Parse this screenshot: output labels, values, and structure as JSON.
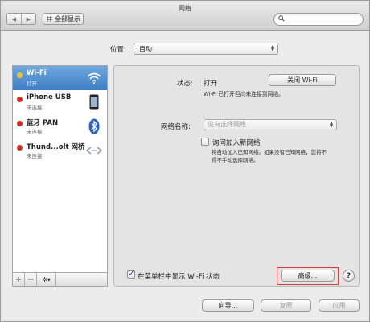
{
  "window": {
    "title": "网络"
  },
  "toolbar": {
    "back_label": "◀",
    "forward_label": "▶",
    "show_all_label": "全部显示",
    "search_placeholder": ""
  },
  "location": {
    "label": "位置:",
    "value": "自动"
  },
  "services": [
    {
      "name": "Wi-Fi",
      "status": "打开",
      "dot_color": "#f2c230",
      "icon": "wifi-icon",
      "selected": true
    },
    {
      "name": "iPhone USB",
      "status": "未连接",
      "dot_color": "#d9291c",
      "icon": "iphone-icon",
      "selected": false
    },
    {
      "name": "蓝牙 PAN",
      "status": "未连接",
      "dot_color": "#d9291c",
      "icon": "bluetooth-icon",
      "selected": false
    },
    {
      "name": "Thund...olt 网桥",
      "status": "未连接",
      "dot_color": "#d9291c",
      "icon": "thunderbolt-bridge-icon",
      "selected": false
    }
  ],
  "sidebar_controls": {
    "add": "+",
    "remove": "−",
    "action": "✲▾"
  },
  "detail": {
    "status_label": "状态:",
    "status_value": "打开",
    "toggle_button": "关闭 Wi-Fi",
    "status_desc": "Wi-Fi 已打开但尚未连接到网络。",
    "network_name_label": "网络名称:",
    "network_name_placeholder": "没有选择网络",
    "ask_join_label": "询问加入新网络",
    "ask_join_checked": false,
    "ask_join_desc_line1": "将自动加入已知网络。如果没有已知网络，您将不",
    "ask_join_desc_line2": "得不手动选择网络。",
    "show_menu_label": "在菜单栏中显示 Wi-Fi 状态",
    "show_menu_checked": true,
    "advanced_button": "高级...",
    "help_label": "?"
  },
  "footer": {
    "assist_button": "向导...",
    "revert_button": "复原",
    "apply_button": "应用"
  },
  "colors": {
    "selection": "#3d7dc4",
    "highlight_box": "#dd3333"
  }
}
